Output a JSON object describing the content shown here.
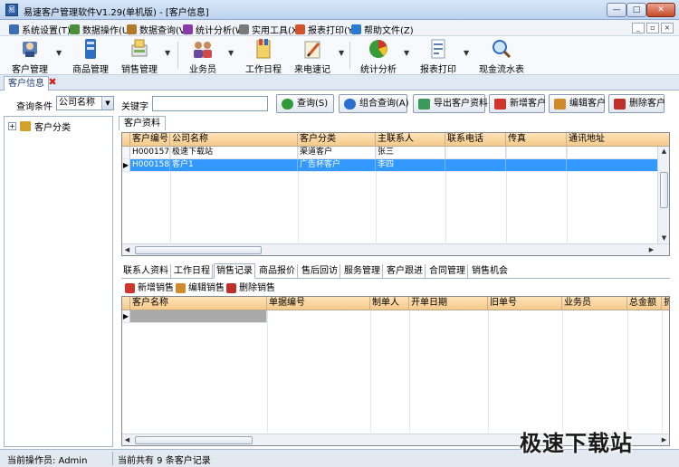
{
  "window": {
    "title": "易速客户管理软件V1.29(单机版) - [客户信息]",
    "controls": {
      "minimize": "—",
      "maximize": "□",
      "close": "✕"
    }
  },
  "menu": {
    "items": [
      {
        "label": "系统设置(T)",
        "icon": "system-icon",
        "color": "#3c6fb4"
      },
      {
        "label": "数据操作(U)",
        "icon": "data-icon",
        "color": "#4a8f3a"
      },
      {
        "label": "数据查询(V)",
        "icon": "query-icon",
        "color": "#b07a2a"
      },
      {
        "label": "统计分析(W)",
        "icon": "stats-icon",
        "color": "#8a3aa8"
      },
      {
        "label": "实用工具(X)",
        "icon": "tools-icon",
        "color": "#7a7a7a"
      },
      {
        "label": "报表打印(Y)",
        "icon": "print-icon",
        "color": "#d0532a"
      },
      {
        "label": "帮助文件(Z)",
        "icon": "help-icon",
        "color": "#2a7ad0"
      }
    ],
    "mdi": {
      "minimize": "_",
      "restore": "▫",
      "close": "×"
    }
  },
  "toolbar": {
    "items": [
      {
        "label": "客户管理",
        "icon": "customer-manage-icon"
      },
      {
        "label": "商品管理",
        "icon": "product-manage-icon"
      },
      {
        "label": "销售管理",
        "icon": "sales-manage-icon"
      },
      {
        "label": "业务员",
        "icon": "salesman-icon"
      },
      {
        "label": "工作日程",
        "icon": "schedule-icon"
      },
      {
        "label": "来电速记",
        "icon": "call-note-icon"
      },
      {
        "label": "统计分析",
        "icon": "analysis-icon"
      },
      {
        "label": "报表打印",
        "icon": "report-print-icon"
      },
      {
        "label": "现金流水表",
        "icon": "cash-flow-icon"
      }
    ],
    "dropdown_glyph": "▼"
  },
  "doc_tab": {
    "label": "客户信息",
    "close": "✖"
  },
  "search": {
    "condition_label": "查询条件",
    "condition_value": "公司名称",
    "keyword_label": "关键字",
    "keyword_value": "",
    "buttons": [
      {
        "label": "查询(S)",
        "color": "#2f9a3a"
      },
      {
        "label": "组合查询(A)",
        "color": "#2a6fd0"
      },
      {
        "label": "导出客户资料",
        "color": "#3a9a5a"
      },
      {
        "label": "新增客户",
        "color": "#d0342a"
      },
      {
        "label": "编辑客户",
        "color": "#d08a2a"
      },
      {
        "label": "删除客户",
        "color": "#c0302a"
      }
    ]
  },
  "tree": {
    "expander": "+",
    "root_label": "客户分类"
  },
  "customer_grid": {
    "tab_label": "客户资料",
    "columns": [
      "客户编号",
      "公司名称",
      "客户分类",
      "主联系人",
      "联系电话",
      "传真",
      "通讯地址"
    ],
    "rows": [
      [
        "H000157",
        "极速下载站",
        "渠道客户",
        "张三",
        "",
        "",
        ""
      ],
      [
        "H000158",
        "客户1",
        "广告杯客户",
        "李四",
        "",
        "",
        ""
      ]
    ],
    "selected_row": 1,
    "row_marker": "▶"
  },
  "detail_tabs": {
    "items": [
      "联系人资料",
      "工作日程",
      "销售记录",
      "商品报价",
      "售后回访",
      "服务管理",
      "客户跟进",
      "合同管理",
      "销售机会"
    ],
    "active": "销售记录"
  },
  "sales_tools": {
    "items": [
      {
        "label": "新增销售",
        "color": "#d0342a"
      },
      {
        "label": "编辑销售",
        "color": "#d08a2a"
      },
      {
        "label": "删除销售",
        "color": "#c0302a"
      }
    ]
  },
  "sales_grid": {
    "columns": [
      "客户名称",
      "单据编号",
      "制单人",
      "开单日期",
      "旧单号",
      "业务员",
      "总金额",
      "折"
    ],
    "row_marker": "▶"
  },
  "status": {
    "operator": "当前操作员: Admin",
    "count": "当前共有 9 条客户记录"
  },
  "watermark": "极速下载站",
  "colors": {
    "selection": "#3399ff",
    "grid_header": "#f5c98a",
    "title_bar": "#bcd3ef"
  }
}
